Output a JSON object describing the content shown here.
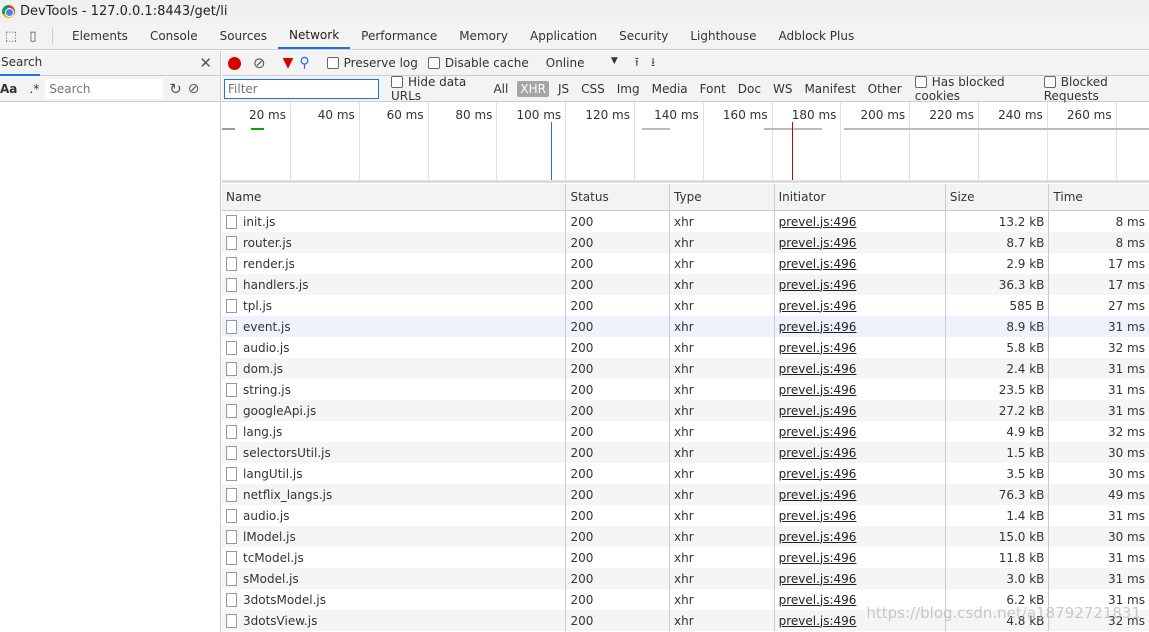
{
  "window": {
    "title": "DevTools - 127.0.0.1:8443/get/li"
  },
  "tabs": [
    "Elements",
    "Console",
    "Sources",
    "Network",
    "Performance",
    "Memory",
    "Application",
    "Security",
    "Lighthouse",
    "Adblock Plus"
  ],
  "active_tab": "Network",
  "search_panel": {
    "title": "Search",
    "match_case": "Aa",
    "regex": ".*",
    "placeholder": "Search"
  },
  "toolbar": {
    "preserve_log": "Preserve log",
    "disable_cache": "Disable cache",
    "throttling": "Online"
  },
  "filterbar": {
    "placeholder": "Filter",
    "hide_data_urls": "Hide data URLs",
    "types": [
      "All",
      "XHR",
      "JS",
      "CSS",
      "Img",
      "Media",
      "Font",
      "Doc",
      "WS",
      "Manifest",
      "Other"
    ],
    "selected_type": "XHR",
    "has_blocked_cookies": "Has blocked cookies",
    "blocked_requests": "Blocked Requests"
  },
  "timeline": {
    "ticks": [
      "20 ms",
      "40 ms",
      "60 ms",
      "80 ms",
      "100 ms",
      "120 ms",
      "140 ms",
      "160 ms",
      "180 ms",
      "200 ms",
      "220 ms",
      "240 ms",
      "260 ms",
      "2"
    ]
  },
  "table": {
    "columns": [
      "Name",
      "Status",
      "Type",
      "Initiator",
      "Size",
      "Time"
    ],
    "rows": [
      [
        "init.js",
        "200",
        "xhr",
        "prevel.js:496",
        "13.2 kB",
        "8 ms"
      ],
      [
        "router.js",
        "200",
        "xhr",
        "prevel.js:496",
        "8.7 kB",
        "8 ms"
      ],
      [
        "render.js",
        "200",
        "xhr",
        "prevel.js:496",
        "2.9 kB",
        "17 ms"
      ],
      [
        "handlers.js",
        "200",
        "xhr",
        "prevel.js:496",
        "36.3 kB",
        "17 ms"
      ],
      [
        "tpl.js",
        "200",
        "xhr",
        "prevel.js:496",
        "585 B",
        "27 ms"
      ],
      [
        "event.js",
        "200",
        "xhr",
        "prevel.js:496",
        "8.9 kB",
        "31 ms"
      ],
      [
        "audio.js",
        "200",
        "xhr",
        "prevel.js:496",
        "5.8 kB",
        "32 ms"
      ],
      [
        "dom.js",
        "200",
        "xhr",
        "prevel.js:496",
        "2.4 kB",
        "31 ms"
      ],
      [
        "string.js",
        "200",
        "xhr",
        "prevel.js:496",
        "23.5 kB",
        "31 ms"
      ],
      [
        "googleApi.js",
        "200",
        "xhr",
        "prevel.js:496",
        "27.2 kB",
        "31 ms"
      ],
      [
        "lang.js",
        "200",
        "xhr",
        "prevel.js:496",
        "4.9 kB",
        "32 ms"
      ],
      [
        "selectorsUtil.js",
        "200",
        "xhr",
        "prevel.js:496",
        "1.5 kB",
        "30 ms"
      ],
      [
        "langUtil.js",
        "200",
        "xhr",
        "prevel.js:496",
        "3.5 kB",
        "30 ms"
      ],
      [
        "netflix_langs.js",
        "200",
        "xhr",
        "prevel.js:496",
        "76.3 kB",
        "49 ms"
      ],
      [
        "audio.js",
        "200",
        "xhr",
        "prevel.js:496",
        "1.4 kB",
        "31 ms"
      ],
      [
        "lModel.js",
        "200",
        "xhr",
        "prevel.js:496",
        "15.0 kB",
        "30 ms"
      ],
      [
        "tcModel.js",
        "200",
        "xhr",
        "prevel.js:496",
        "11.8 kB",
        "31 ms"
      ],
      [
        "sModel.js",
        "200",
        "xhr",
        "prevel.js:496",
        "3.0 kB",
        "31 ms"
      ],
      [
        "3dotsModel.js",
        "200",
        "xhr",
        "prevel.js:496",
        "6.2 kB",
        "31 ms"
      ],
      [
        "3dotsView.js",
        "200",
        "xhr",
        "prevel.js:496",
        "4.8 kB",
        "32 ms"
      ]
    ],
    "highlighted_row": 5
  },
  "watermark": "https://blog.csdn.net/a18792721831"
}
